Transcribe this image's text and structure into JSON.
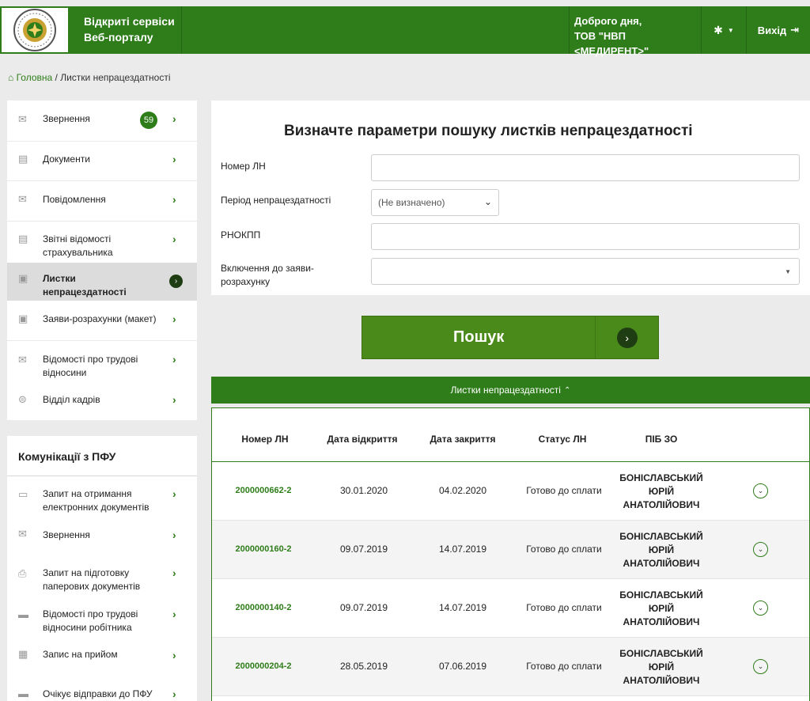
{
  "header": {
    "site_title_line1": "Відкриті сервіси",
    "site_title_line2": "Веб-порталу",
    "greeting_line1": "Доброго дня,",
    "greeting_line2": "ТОВ \"НВП <МЕДИРЕНТ>\"",
    "settings_icon": "gear-icon",
    "logout_label": "Вихід"
  },
  "breadcrumb": {
    "home": "Головна",
    "separator": "/",
    "current": "Листки непрацездатності"
  },
  "sidebar": {
    "items": [
      {
        "label": "Звернення",
        "icon": "envelope-icon",
        "badge": "59"
      },
      {
        "label": "Документи",
        "icon": "document-icon"
      },
      {
        "label": "Повідомлення",
        "icon": "envelope-icon"
      },
      {
        "label": "Звітні відомості страхувальника",
        "icon": "document-icon"
      },
      {
        "label": "Листки непрацездатності",
        "icon": "medical-doc-icon",
        "active": true
      },
      {
        "label": "Заяви-розрахунки (макет)",
        "icon": "medical-doc-icon"
      },
      {
        "label": "Відомості про трудові відносини",
        "icon": "envelope-icon"
      },
      {
        "label": "Відділ кадрів",
        "icon": "list-circle-icon"
      }
    ]
  },
  "communications": {
    "title": "Комунікації з ПФУ",
    "items": [
      {
        "label": "Запит на отримання електронних документів",
        "icon": "e-doc-icon"
      },
      {
        "label": "Звернення",
        "icon": "open-envelope-icon"
      },
      {
        "label": "Запит на підготовку паперових документів",
        "icon": "printer-icon"
      },
      {
        "label": "Відомості про трудові відносини робітника",
        "icon": "folder-icon"
      },
      {
        "label": "Запис на прийом",
        "icon": "calendar-icon"
      },
      {
        "label": "Очікує відправки до ПФУ",
        "icon": "folder-icon"
      }
    ]
  },
  "form": {
    "title": "Визначте параметри пошуку листків непрацездатності",
    "number_label": "Номер ЛН",
    "number_value": "",
    "period_label": "Період непрацездатності",
    "period_value": "(Не визначено)",
    "rnokpp_label": "РНОКПП",
    "rnokpp_value": "",
    "inclusion_label": "Включення до заяви-розрахунку",
    "inclusion_value": "",
    "search_label": "Пошук"
  },
  "results": {
    "title": "Листки непрацездатності",
    "columns": [
      "Номер ЛН",
      "Дата відкриття",
      "Дата закриття",
      "Статус ЛН",
      "ПІБ ЗО"
    ],
    "rows": [
      {
        "number": "2000000662-2",
        "opened": "30.01.2020",
        "closed": "04.02.2020",
        "status": "Готово до сплати",
        "name": "БОНІСЛАВСЬКИЙ ЮРІЙ АНАТОЛІЙОВИЧ"
      },
      {
        "number": "2000000160-2",
        "opened": "09.07.2019",
        "closed": "14.07.2019",
        "status": "Готово до сплати",
        "name": "БОНІСЛАВСЬКИЙ ЮРІЙ АНАТОЛІЙОВИЧ"
      },
      {
        "number": "2000000140-2",
        "opened": "09.07.2019",
        "closed": "14.07.2019",
        "status": "Готово до сплати",
        "name": "БОНІСЛАВСЬКИЙ ЮРІЙ АНАТОЛІЙОВИЧ"
      },
      {
        "number": "2000000204-2",
        "opened": "28.05.2019",
        "closed": "07.06.2019",
        "status": "Готово до сплати",
        "name": "БОНІСЛАВСЬКИЙ ЮРІЙ АНАТОЛІЙОВИЧ"
      }
    ]
  },
  "colors": {
    "brand_green": "#2e7d1a",
    "button_green": "#4a8a1a",
    "dark_green": "#1e3d12"
  }
}
